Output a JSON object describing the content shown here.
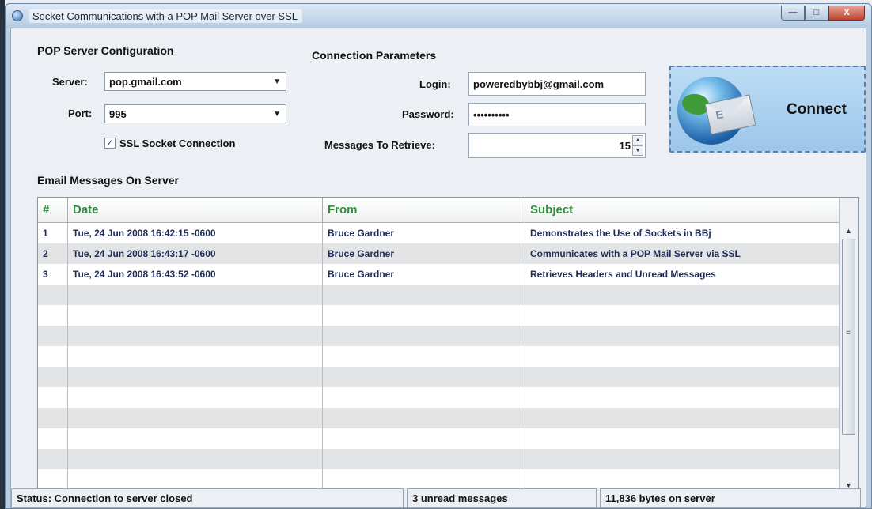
{
  "window": {
    "title": "Socket Communications with a POP Mail Server over SSL",
    "buttons": {
      "minimize": "—",
      "maximize": "□",
      "close": "X"
    }
  },
  "pop_config": {
    "group_label": "POP Server Configuration",
    "server_label": "Server:",
    "server_value": "pop.gmail.com",
    "port_label": "Port:",
    "port_value": "995",
    "ssl_label": "SSL Socket Connection",
    "ssl_checked": true
  },
  "connection": {
    "group_label": "Connection Parameters",
    "login_label": "Login:",
    "login_value": "poweredbybbj@gmail.com",
    "password_label": "Password:",
    "password_value": "••••••••••",
    "messages_label": "Messages To Retrieve:",
    "messages_value": "15"
  },
  "connect_button": {
    "label": "Connect"
  },
  "messages": {
    "group_label": "Email Messages On Server",
    "columns": [
      "#",
      "Date",
      "From",
      "Subject"
    ],
    "rows": [
      [
        "1",
        "Tue, 24 Jun 2008 16:42:15 -0600",
        "Bruce Gardner",
        "Demonstrates the Use of Sockets in BBj"
      ],
      [
        "2",
        "Tue, 24 Jun 2008 16:43:17 -0600",
        "Bruce Gardner",
        "Communicates with a POP Mail Server via SSL"
      ],
      [
        "3",
        "Tue, 24 Jun 2008 16:43:52 -0600",
        "Bruce Gardner",
        "Retrieves Headers and Unread Messages"
      ],
      [
        "",
        "",
        "",
        ""
      ],
      [
        "",
        "",
        "",
        ""
      ],
      [
        "",
        "",
        "",
        ""
      ],
      [
        "",
        "",
        "",
        ""
      ],
      [
        "",
        "",
        "",
        ""
      ],
      [
        "",
        "",
        "",
        ""
      ],
      [
        "",
        "",
        "",
        ""
      ],
      [
        "",
        "",
        "",
        ""
      ],
      [
        "",
        "",
        "",
        ""
      ],
      [
        "",
        "",
        "",
        ""
      ]
    ]
  },
  "status": {
    "connection": "Status: Connection to server closed",
    "unread": "3 unread messages",
    "bytes": "11,836 bytes on server"
  },
  "colors": {
    "header_text": "#2f8f3a",
    "row_text": "#1e2d57",
    "connect_bg": "#9cc6ea"
  }
}
